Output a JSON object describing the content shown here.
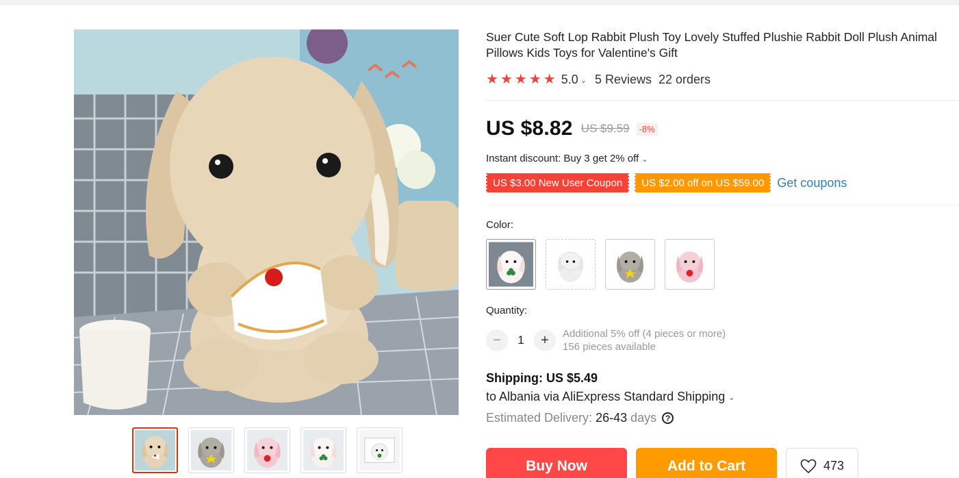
{
  "product": {
    "title": "Suer Cute Soft Lop Rabbit Plush Toy Lovely Stuffed Plushie Rabbit Doll Plush Animal Pillows Kids Toys for Valentine's Gift",
    "rating": "5.0",
    "stars": 5,
    "reviews": "5 Reviews",
    "orders": "22 orders"
  },
  "price": {
    "current": "US $8.82",
    "original": "US $9.59",
    "discount": "-8%"
  },
  "instant_discount": "Instant discount: Buy 3 get 2% off",
  "coupons": {
    "new_user": "US $3.00 New User Coupon",
    "store": "US $2.00 off on US $59.00",
    "get_label": "Get coupons"
  },
  "color": {
    "label": "Color:",
    "options": [
      "white-green-rabbit",
      "white-rabbit",
      "gray-rabbit",
      "pink-rabbit"
    ],
    "selected_index": 0
  },
  "quantity": {
    "label": "Quantity:",
    "value": "1",
    "minus": "−",
    "plus": "+",
    "note": "Additional 5% off (4 pieces or more)",
    "available": "156 pieces available"
  },
  "shipping": {
    "cost": "Shipping: US $5.49",
    "destination": "to Albania via AliExpress Standard Shipping",
    "delivery_label": "Estimated Delivery:",
    "delivery_days": "26-43",
    "days_unit": "days",
    "help": "?"
  },
  "actions": {
    "buy_now": "Buy Now",
    "add_to_cart": "Add to Cart",
    "wishlist_count": "473"
  },
  "icons": {
    "star": "★",
    "chevron": "⌄",
    "heart": "heart-icon"
  },
  "colors": {
    "accent_red": "#f44336",
    "buy_now": "#ff4747",
    "add_to_cart": "#ff9a00",
    "coupon_orange": "#ff9800",
    "link_blue": "#2e7fb8"
  },
  "thumbnails": [
    "beige-rabbit",
    "gray-rabbit",
    "pink-rabbit",
    "white-green-rabbit",
    "white-rabbit-box"
  ],
  "active_thumbnail": 0
}
